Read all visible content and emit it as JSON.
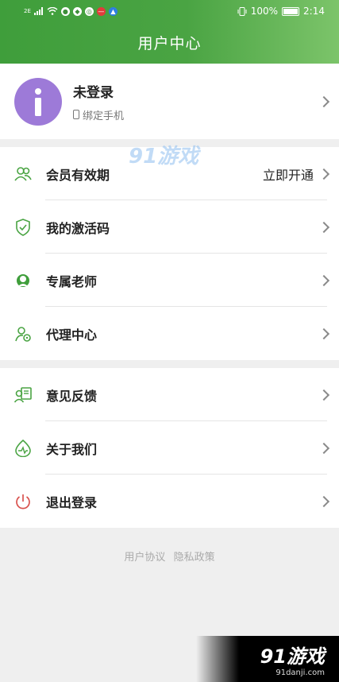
{
  "status_bar": {
    "left_small": "2E",
    "battery_percent": "100%",
    "time": "2:14"
  },
  "header": {
    "title": "用户中心"
  },
  "user": {
    "name": "未登录",
    "sub": "绑定手机"
  },
  "menu_group_1": [
    {
      "label": "会员有效期",
      "right": "立即开通",
      "icon": "members-icon"
    },
    {
      "label": "我的激活码",
      "right": "",
      "icon": "shield-check-icon"
    },
    {
      "label": "专属老师",
      "right": "",
      "icon": "headset-icon"
    },
    {
      "label": "代理中心",
      "right": "",
      "icon": "user-agent-icon"
    }
  ],
  "menu_group_2": [
    {
      "label": "意见反馈",
      "right": "",
      "icon": "feedback-icon"
    },
    {
      "label": "关于我们",
      "right": "",
      "icon": "about-icon"
    },
    {
      "label": "退出登录",
      "right": "",
      "icon": "power-icon"
    }
  ],
  "footer": {
    "link_agreement": "用户协议",
    "link_privacy": "隐私政策"
  },
  "watermark": {
    "top": "91游戏",
    "bottom_main": "91游戏",
    "bottom_sub": "91danji.com"
  },
  "colors": {
    "accent": "#4aa443",
    "avatar": "#9d7ad8",
    "logout_icon": "#d9534f"
  }
}
